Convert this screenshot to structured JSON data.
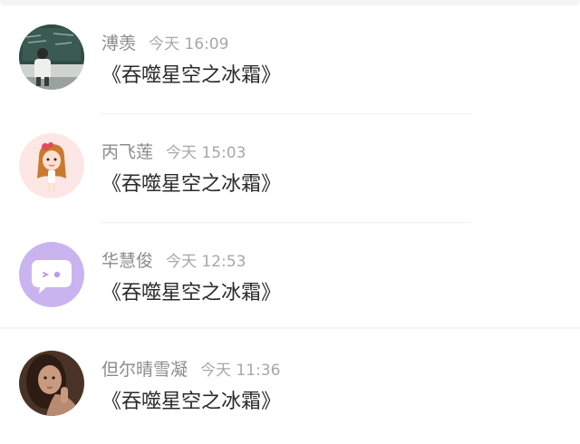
{
  "comments": [
    {
      "name": "溥羡",
      "time": "今天 16:09",
      "message": "《吞噬星空之冰霜》",
      "avatar": "classroom-photo-avatar"
    },
    {
      "name": "丙飞莲",
      "time": "今天 15:03",
      "message": "《吞噬星空之冰霜》",
      "avatar": "cartoon-girl-avatar"
    },
    {
      "name": "华慧俊",
      "time": "今天 12:53",
      "message": "《吞噬星空之冰霜》",
      "avatar": "chat-bubble-avatar"
    },
    {
      "name": "但尔晴雪凝",
      "time": "今天 11:36",
      "message": "《吞噬星空之冰霜》",
      "avatar": "woman-portrait-avatar"
    }
  ],
  "colors": {
    "name": "#8c8c8c",
    "time": "#a8a8a8",
    "message": "#2b2b2b",
    "bubble_avatar_bg": "#c9b4f0",
    "girl_avatar_bg": "#fde7e4"
  }
}
